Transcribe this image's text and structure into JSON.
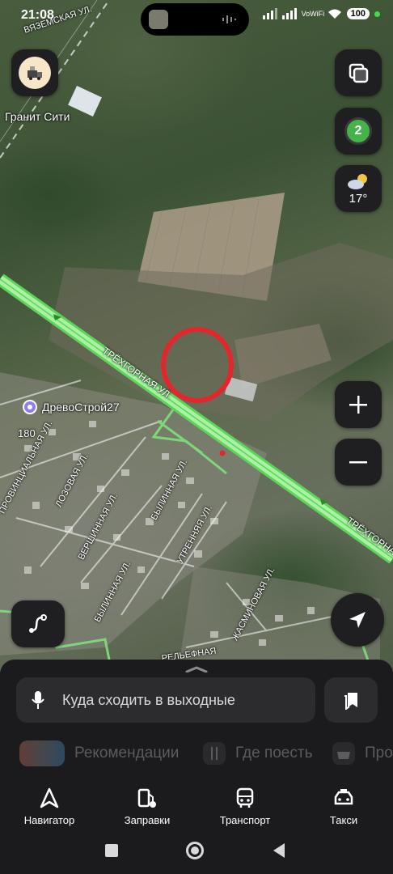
{
  "status_bar": {
    "time": "21:08",
    "network": "VoWiFi",
    "battery": "100"
  },
  "map": {
    "streets": {
      "vyazemskaya": "ВЯЗЕМСКАЯ УЛ.",
      "trekhgornaya": "ТРЁХГОРНАЯ УЛ.",
      "trekhgornaya_right": "ТРЁХГОРНАЯ",
      "provintsialnaya": "ПРОВИНЦИАЛЬНАЯ УЛ.",
      "lozovaya": "ЛОЗОВАЯ УЛ.",
      "vershinnaya": "ВЕРШИННАЯ УЛ.",
      "bylinnaya": "БЫЛИННАЯ УЛ.",
      "bylinnaya2": "БЫЛИННАЯ УЛ.",
      "utrennyaya": "УТРЕННЯЯ УЛ.",
      "zhasminovaya": "ЖАСМИНОВАЯ УЛ.",
      "relefnaya": "РЕЛЬЕФНАЯ"
    },
    "poi_granit": "Гранит Сити",
    "poi_drevostroy": "ДревоСтрой27",
    "house_number": "180",
    "highlight_color": "#e3262b"
  },
  "controls": {
    "layers_badge": "2",
    "weather_temp": "17°"
  },
  "bottom_sheet": {
    "search_placeholder": "Куда сходить в выходные",
    "chips": [
      {
        "label": "Рекомендации",
        "icon": "recommendations-icon"
      },
      {
        "label": "Где поесть",
        "icon": "fork-knife-icon"
      },
      {
        "label": "Про",
        "icon": "basket-icon"
      }
    ],
    "nav": [
      {
        "label": "Навигатор",
        "icon": "navigator-icon"
      },
      {
        "label": "Заправки",
        "icon": "fuel-icon"
      },
      {
        "label": "Транспорт",
        "icon": "bus-icon"
      },
      {
        "label": "Такси",
        "icon": "taxi-icon"
      }
    ]
  },
  "colors": {
    "accent_green": "#8ef08a",
    "sheet_bg": "#1b1b1d",
    "fab_bg": "#1f1f21"
  }
}
